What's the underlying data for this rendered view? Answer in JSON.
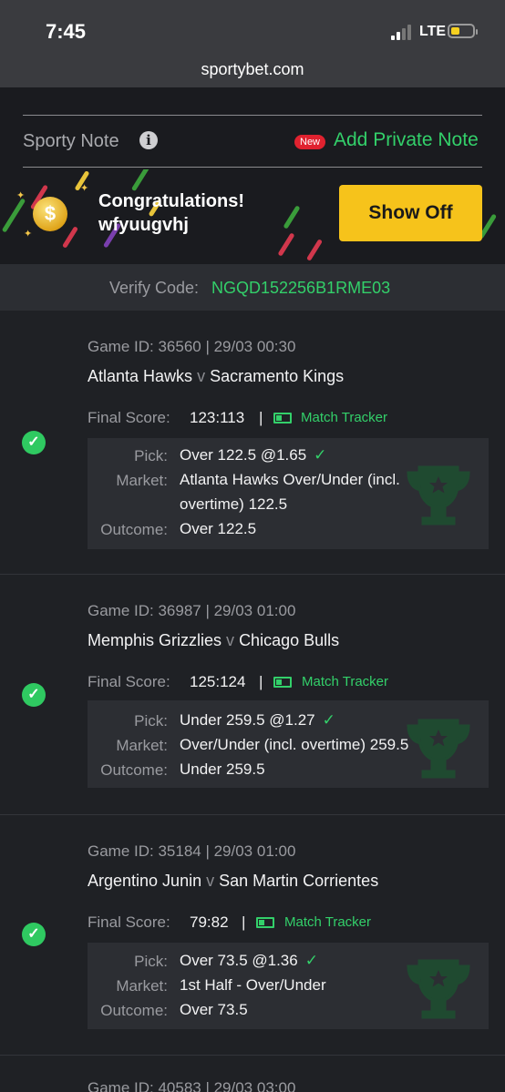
{
  "status": {
    "time": "7:45",
    "network": "LTE"
  },
  "browser": {
    "url": "sportybet.com"
  },
  "note": {
    "label": "Sporty Note",
    "new_badge": "New",
    "add_label": "Add Private Note"
  },
  "banner": {
    "title": "Congratulations!",
    "username": "wfyuugvhj",
    "button": "Show Off"
  },
  "verify": {
    "label": "Verify Code:",
    "code": "NGQD152256B1RME03"
  },
  "bets": [
    {
      "meta": "Game ID: 36560 | 29/03 00:30",
      "home": "Atlanta Hawks",
      "vs": "v",
      "away": "Sacramento Kings",
      "score_label": "Final Score:",
      "score": "123:113",
      "sep": "|",
      "tracker": "Match Tracker",
      "pick_label": "Pick:",
      "pick": "Over 122.5 @1.65",
      "market_label": "Market:",
      "market": "Atlanta Hawks Over/Under (incl. overtime) 122.5",
      "outcome_label": "Outcome:",
      "outcome": "Over 122.5"
    },
    {
      "meta": "Game ID: 36987 | 29/03 01:00",
      "home": "Memphis Grizzlies",
      "vs": "v",
      "away": "Chicago Bulls",
      "score_label": "Final Score:",
      "score": "125:124",
      "sep": "|",
      "tracker": "Match Tracker",
      "pick_label": "Pick:",
      "pick": "Under 259.5 @1.27",
      "market_label": "Market:",
      "market": "Over/Under (incl. overtime) 259.5",
      "outcome_label": "Outcome:",
      "outcome": "Under 259.5"
    },
    {
      "meta": "Game ID: 35184 | 29/03 01:00",
      "home": "Argentino Junin",
      "vs": "v",
      "away": "San Martin Corrientes",
      "score_label": "Final Score:",
      "score": "79:82",
      "sep": "|",
      "tracker": "Match Tracker",
      "pick_label": "Pick:",
      "pick": "Over 73.5 @1.36",
      "market_label": "Market:",
      "market": "1st Half - Over/Under",
      "outcome_label": "Outcome:",
      "outcome": "Over 73.5"
    },
    {
      "meta": "Game ID: 40583 | 29/03 03:00"
    }
  ],
  "icons": {
    "check": "check-circle-icon",
    "tracker": "match-tracker-icon",
    "trophy": "trophy-icon"
  },
  "colors": {
    "accent_green": "#33d06a",
    "button_yellow": "#f6c31b",
    "badge_red": "#e0222f"
  }
}
